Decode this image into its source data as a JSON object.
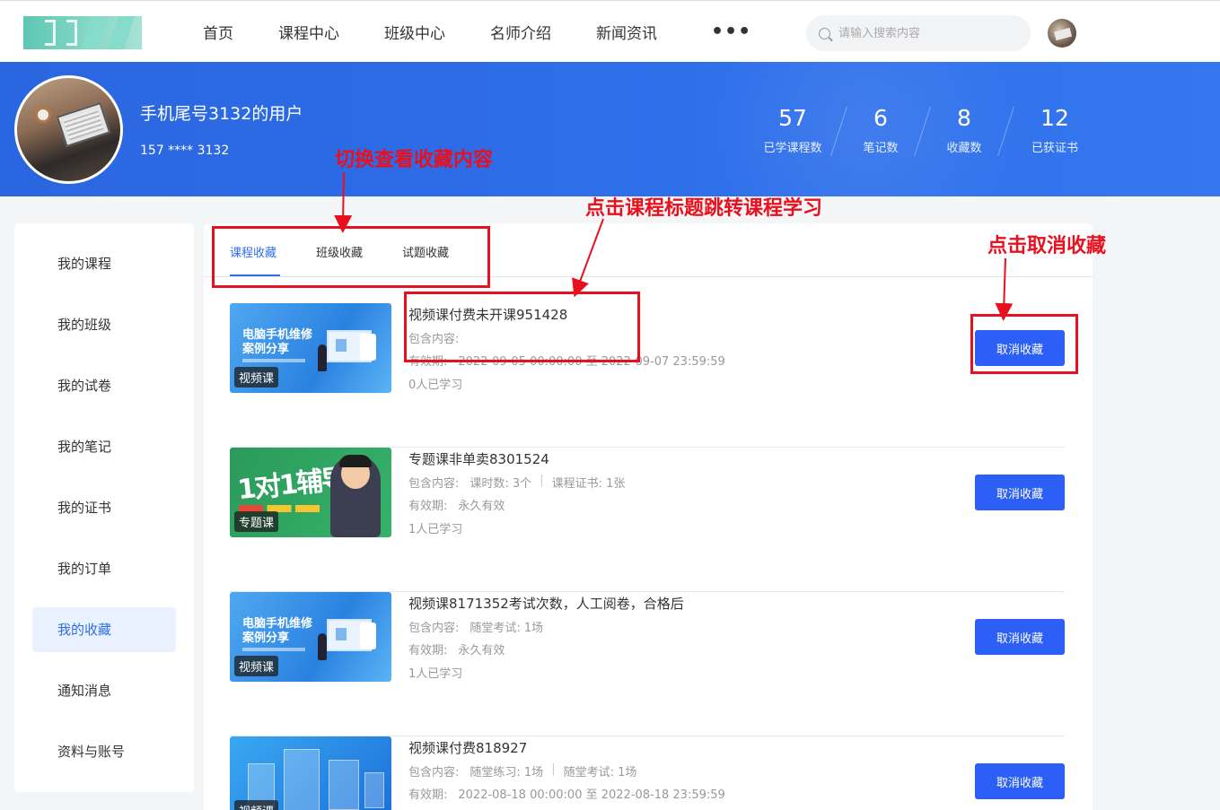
{
  "nav": {
    "items": [
      "首页",
      "课程中心",
      "班级中心",
      "名师介绍",
      "新闻资讯"
    ],
    "more": "•••",
    "search_placeholder": "请输入搜索内容"
  },
  "profile": {
    "name": "手机尾号3132的用户",
    "phone": "157 **** 3132",
    "stats": [
      {
        "num": "57",
        "label": "已学课程数"
      },
      {
        "num": "6",
        "label": "笔记数"
      },
      {
        "num": "8",
        "label": "收藏数"
      },
      {
        "num": "12",
        "label": "已获证书"
      }
    ]
  },
  "sidebar": {
    "items": [
      "我的课程",
      "我的班级",
      "我的试卷",
      "我的笔记",
      "我的证书",
      "我的订单",
      "我的收藏",
      "通知消息",
      "资料与账号"
    ],
    "active_index": 6
  },
  "tabs": [
    "课程收藏",
    "班级收藏",
    "试题收藏"
  ],
  "courses": [
    {
      "badge": "视频课",
      "thumb_title": "电脑手机维修\n案例分享",
      "title": "视频课付费未开课951428",
      "contains_label": "包含内容:",
      "validity_label": "有效期:",
      "validity_value": "2022-09-05 00:00:00 至 2022-09-07 23:59:59",
      "learners": "0人已学习",
      "button": "取消收藏"
    },
    {
      "badge": "专题课",
      "thumb_title": "1对1辅导",
      "title": "专题课非单卖8301524",
      "contains_label": "包含内容:",
      "contains_items": [
        "课时数: 3个",
        "课程证书: 1张"
      ],
      "validity_label": "有效期:",
      "validity_value": "永久有效",
      "learners": "1人已学习",
      "button": "取消收藏"
    },
    {
      "badge": "视频课",
      "thumb_title": "电脑手机维修\n案例分享",
      "title": "视频课8171352考试次数，人工阅卷，合格后",
      "contains_label": "包含内容:",
      "contains_items": [
        "随堂考试: 1场"
      ],
      "validity_label": "有效期:",
      "validity_value": "永久有效",
      "learners": "1人已学习",
      "button": "取消收藏"
    },
    {
      "badge": "视频课",
      "title": "视频课付费818927",
      "contains_label": "包含内容:",
      "contains_items": [
        "随堂练习: 1场",
        "随堂考试: 1场"
      ],
      "validity_label": "有效期:",
      "validity_value": "2022-08-18 00:00:00 至 2022-08-18 23:59:59",
      "button": "取消收藏"
    }
  ],
  "annotations": {
    "tabs_note": "切换查看收藏内容",
    "title_note": "点击课程标题跳转课程学习",
    "cancel_note": "点击取消收藏",
    "color": "#e8101e"
  },
  "colors": {
    "primary": "#2f6fea",
    "button": "#2b5ff5",
    "annotation": "#e8101e"
  }
}
